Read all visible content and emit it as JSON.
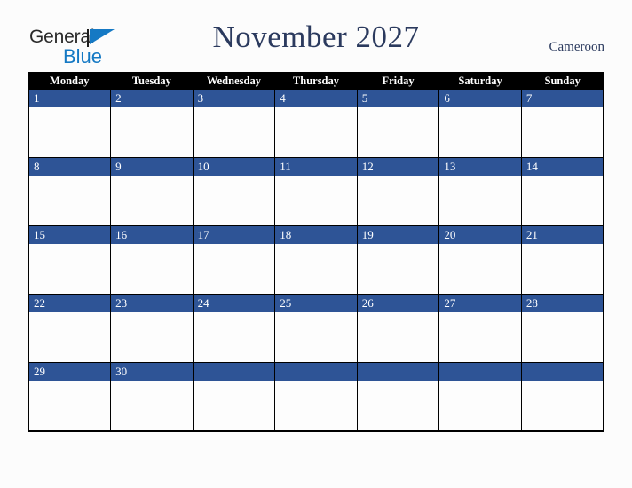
{
  "logo": {
    "word1": "General",
    "word2": "Blue",
    "triangle_color": "#1579c4",
    "text_color": "#2b2b2b"
  },
  "header": {
    "title": "November 2027",
    "country": "Cameroon",
    "title_color": "#2b3a5e"
  },
  "calendar": {
    "month": "November",
    "year": "2027",
    "first_day_of_week": "Monday",
    "header_bg": "#000000",
    "header_fg": "#ffffff",
    "daynum_band_color": "#2e5496",
    "cell_bg": "#fdfdfd",
    "grid_line_color": "#000000",
    "weekdays": [
      "Monday",
      "Tuesday",
      "Wednesday",
      "Thursday",
      "Friday",
      "Saturday",
      "Sunday"
    ],
    "weeks": [
      [
        "1",
        "2",
        "3",
        "4",
        "5",
        "6",
        "7"
      ],
      [
        "8",
        "9",
        "10",
        "11",
        "12",
        "13",
        "14"
      ],
      [
        "15",
        "16",
        "17",
        "18",
        "19",
        "20",
        "21"
      ],
      [
        "22",
        "23",
        "24",
        "25",
        "26",
        "27",
        "28"
      ],
      [
        "29",
        "30",
        "",
        "",
        "",
        "",
        ""
      ]
    ]
  },
  "page": {
    "background": "#fcfcfc"
  }
}
